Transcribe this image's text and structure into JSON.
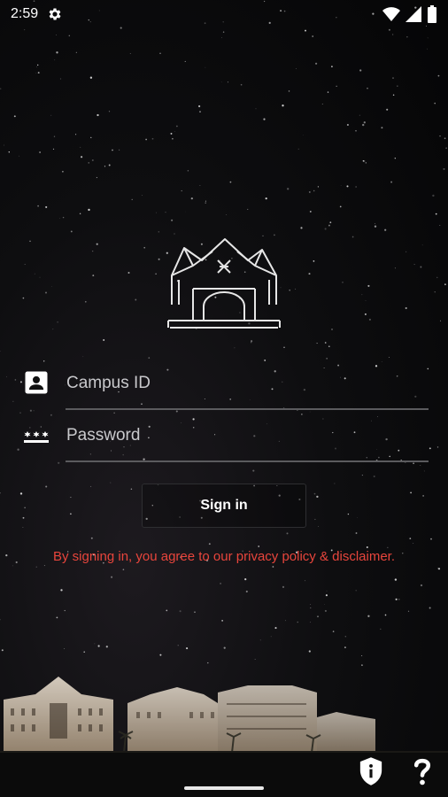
{
  "status_bar": {
    "time": "2:59"
  },
  "login": {
    "campus_id_placeholder": "Campus ID",
    "password_placeholder": "Password",
    "sign_in_label": "Sign in",
    "disclaimer": "By signing in, you agree to our privacy policy & disclaimer."
  },
  "colors": {
    "background": "#0b0b0d",
    "disclaimer_text": "#e8453c",
    "field_underline": "#5b5b5e"
  },
  "icons": {
    "status": [
      "settings-gear-icon",
      "wifi-icon",
      "cell-signal-icon",
      "battery-icon"
    ],
    "fields": [
      "contact-card-icon",
      "password-dots-icon"
    ],
    "bottom": [
      "shield-info-icon",
      "help-question-icon"
    ]
  }
}
